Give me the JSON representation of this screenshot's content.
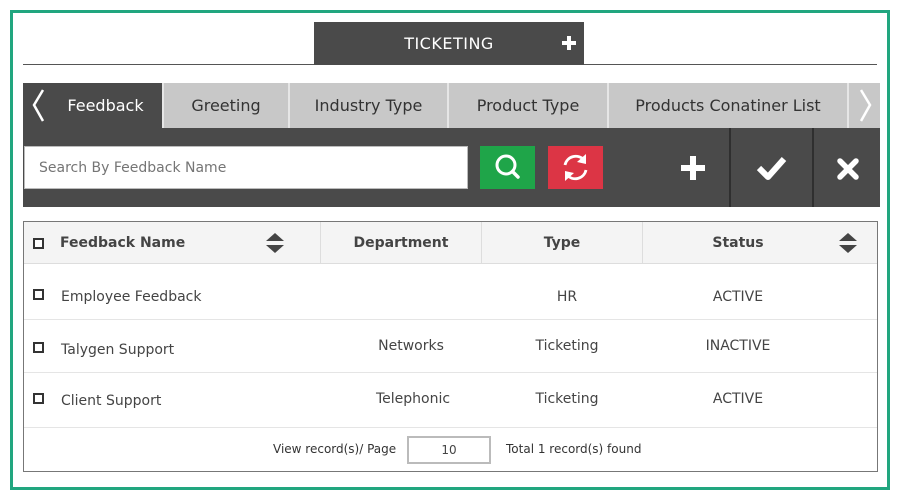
{
  "header": {
    "title": "TICKETING",
    "add_icon": "plus-icon"
  },
  "tabs": {
    "items": [
      {
        "label": "Feedback",
        "active": true
      },
      {
        "label": "Greeting",
        "active": false
      },
      {
        "label": "Industry Type",
        "active": false
      },
      {
        "label": "Product Type",
        "active": false
      },
      {
        "label": "Products Conatiner List",
        "active": false
      }
    ],
    "prev_icon": "chevron-left-icon",
    "next_icon": "chevron-right-icon"
  },
  "toolbar": {
    "search_placeholder": "Search By Feedback Name",
    "search_icon": "search-icon",
    "refresh_icon": "refresh-icon",
    "add_icon": "plus-icon",
    "confirm_icon": "check-icon",
    "delete_icon": "close-icon"
  },
  "colors": {
    "frame_border": "#21a67f",
    "dark_bar": "#4a4a4a",
    "search_button": "#1fa549",
    "refresh_button": "#dc3545",
    "tab_bar": "#c8c8c8"
  },
  "table": {
    "columns": [
      "Feedback Name",
      "Department",
      "Type",
      "Status"
    ],
    "rows": [
      {
        "name": "Employee Feedback",
        "department": "",
        "type": "HR",
        "status": "ACTIVE"
      },
      {
        "name": "Talygen Support",
        "department": "Networks",
        "type": "Ticketing",
        "status": "INACTIVE"
      },
      {
        "name": "Client Support",
        "department": "Telephonic",
        "type": "Ticketing",
        "status": "ACTIVE"
      }
    ]
  },
  "footer": {
    "per_page_label": "View record(s)/ Page",
    "per_page_value": "10",
    "total_label": "Total 1 record(s) found"
  }
}
